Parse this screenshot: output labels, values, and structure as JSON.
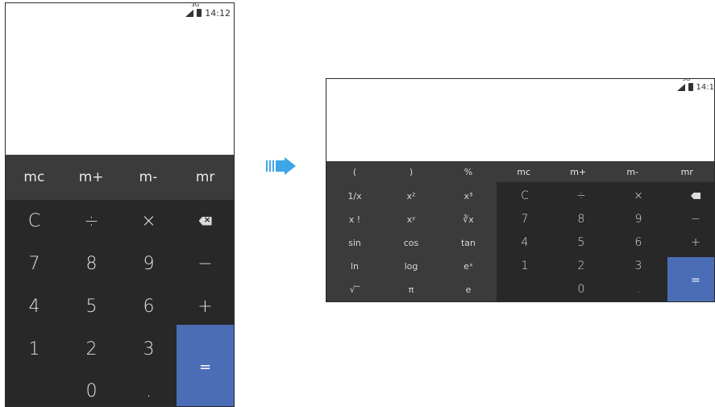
{
  "status": {
    "network": "3G",
    "time": "14:12",
    "time_landscape": "14:1"
  },
  "portrait": {
    "memory": [
      "mc",
      "m+",
      "m-",
      "mr"
    ],
    "rows": [
      [
        "C",
        "÷",
        "×",
        ""
      ],
      [
        "7",
        "8",
        "9",
        "−"
      ],
      [
        "4",
        "5",
        "6",
        "+"
      ],
      [
        "1",
        "2",
        "3",
        ""
      ],
      [
        "",
        "0",
        ".",
        ""
      ]
    ],
    "equals": "="
  },
  "landscape": {
    "memory": [
      "mc",
      "m+",
      "m-",
      "mr"
    ],
    "sci_top": [
      "(",
      ")",
      "%"
    ],
    "sci": [
      [
        "1/x",
        "x²",
        "x³"
      ],
      [
        "x !",
        "xʸ",
        "∛x"
      ],
      [
        "sin",
        "cos",
        "tan"
      ],
      [
        "ln",
        "log",
        "eˣ"
      ],
      [
        "√‾",
        "π",
        "e"
      ]
    ],
    "main": [
      [
        "C",
        "÷",
        "×",
        ""
      ],
      [
        "7",
        "8",
        "9",
        "−"
      ],
      [
        "4",
        "5",
        "6",
        "+"
      ],
      [
        "1",
        "2",
        "3",
        ""
      ],
      [
        "",
        "0",
        ".",
        ""
      ]
    ],
    "equals": "="
  },
  "colors": {
    "accent": "#4a6db6",
    "arrow": "#3ea5e6",
    "panel_dark": "#282828",
    "panel_mid": "#3b3b3b"
  }
}
